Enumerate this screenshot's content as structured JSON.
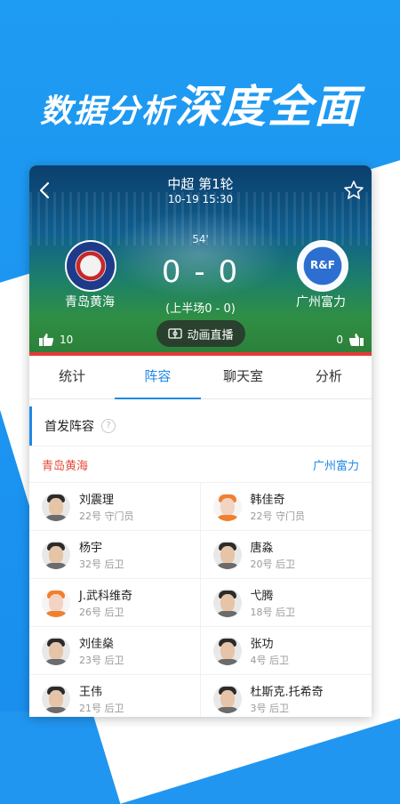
{
  "promo": {
    "text_small": "数据分析",
    "text_big": "深度全面"
  },
  "match": {
    "league_round": "中超  第1轮",
    "datetime": "10-19 15:30",
    "minute": "54'",
    "score": "0 - 0",
    "half_score": "(上半场0 - 0)",
    "live_button": "动画直播",
    "home_team": "青岛黄海",
    "away_team": "广州富力",
    "away_badge_text": "R&F",
    "home_likes": "10",
    "away_likes": "0"
  },
  "tabs": [
    {
      "label": "统计"
    },
    {
      "label": "阵容"
    },
    {
      "label": "聊天室"
    },
    {
      "label": "分析"
    }
  ],
  "lineup": {
    "title": "首发阵容",
    "help": "?",
    "home_team": "青岛黄海",
    "away_team": "广州富力",
    "players": [
      {
        "home_name": "刘震理",
        "home_pos": "22号 守门员",
        "away_name": "韩佳奇",
        "away_pos": "22号 守门员"
      },
      {
        "home_name": "杨宇",
        "home_pos": "32号 后卫",
        "away_name": "唐淼",
        "away_pos": "20号 后卫"
      },
      {
        "home_name": "J.武科维奇",
        "home_pos": "26号 后卫",
        "away_name": "弋腾",
        "away_pos": "18号 后卫"
      },
      {
        "home_name": "刘佳燊",
        "home_pos": "23号 后卫",
        "away_name": "张功",
        "away_pos": "4号 后卫"
      },
      {
        "home_name": "王伟",
        "home_pos": "21号 后卫",
        "away_name": "杜斯克.托希奇",
        "away_pos": "3号 后卫"
      }
    ]
  }
}
